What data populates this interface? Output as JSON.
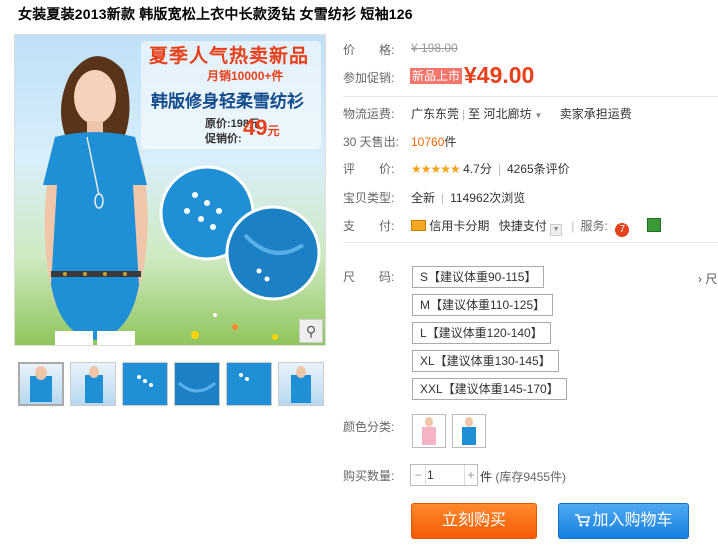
{
  "product": {
    "title": "女装夏装2013新款 韩版宽松上衣中长款烫钻 女雪纺衫 短袖126"
  },
  "banner": {
    "line1": "夏季人气热卖新品",
    "line2": "月销10000+件",
    "line3": "韩版修身轻柔雪纺衫",
    "original_price": "原价:198元",
    "promo_price_label": "促销价:",
    "promo_price": "49",
    "promo_price_unit": "元"
  },
  "thumbnails": {
    "count": 6,
    "active_index": 0
  },
  "price": {
    "label": "价　　格:",
    "original": "¥ 198.00"
  },
  "promotion": {
    "label": "参加促销:",
    "tag": "新品上市",
    "price": "¥49.00"
  },
  "shipping": {
    "label": "物流运费:",
    "from": "广东东莞",
    "to_prefix": "至",
    "to": "河北廊坊",
    "fee": "卖家承担运费"
  },
  "sales": {
    "label": "30 天售出:",
    "count": "10760",
    "unit": "件"
  },
  "rating": {
    "label": "评　　价:",
    "stars": "★★★★★",
    "score": "4.7分",
    "reviews": "4265条评价"
  },
  "type": {
    "label": "宝贝类型:",
    "value": "全新",
    "views": "114962次浏览"
  },
  "payment": {
    "label": "支　　付:",
    "credit": "信用卡分期",
    "quick": "快捷支付",
    "service_label": "服务:"
  },
  "size": {
    "label": "尺　　码:",
    "options": [
      "S【建议体重90-115】",
      "M【建议体重110-125】",
      "L【建议体重120-140】",
      "XL【建议体重130-145】",
      "XXL【建议体重145-170】"
    ],
    "chart_link": "› 尺"
  },
  "color": {
    "label": "颜色分类:"
  },
  "quantity": {
    "label": "购买数量:",
    "value": "1",
    "unit": "件",
    "stock": "(库存9455件)"
  },
  "actions": {
    "buy_now": "立刻购买",
    "add_cart": "加入购物车"
  },
  "colors": {
    "accent": "#e8401b",
    "buy": "#f35b04",
    "cart": "#1780df",
    "main_blouse": "#1f8fd6"
  },
  "icons": [
    "magnifier-icon",
    "chevron-down-icon",
    "credit-card-icon",
    "service-7day-icon",
    "service-badge-icon",
    "cart-icon"
  ]
}
